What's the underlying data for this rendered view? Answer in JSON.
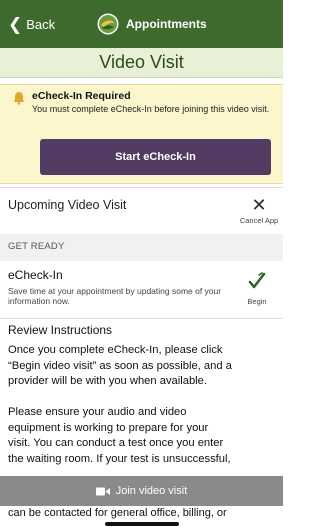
{
  "nav": {
    "back_label": "Back",
    "app_title": "Appointments"
  },
  "page": {
    "title": "Video Visit"
  },
  "banner": {
    "title": "eCheck-In Required",
    "text": "You must complete eCheck-In before joining this video visit.",
    "button_label": "Start eCheck-In"
  },
  "upcoming": {
    "label": "Upcoming Video Visit",
    "cancel_label": "Cancel App"
  },
  "get_ready": {
    "section_label": "GET READY",
    "echeckin_title": "eCheck-In",
    "echeckin_text": "Save time at your appointment by updating some of your information now.",
    "begin_label": "Begin"
  },
  "review": {
    "title": "Review Instructions",
    "para1": [
      "Once you complete eCheck-In, please click",
      "“Begin video visit” as soon as possible, and a",
      "provider will be with you when available."
    ],
    "para2": [
      "Please ensure your audio and video",
      "equipment is working to prepare for your",
      "visit. You can conduct a test once you enter",
      "the waiting room. If your test is unsuccessful,"
    ],
    "partial_line": "can be contacted for general office, billing, or"
  },
  "join": {
    "label": "Join video visit"
  },
  "colors": {
    "header_green": "#3e6b2d",
    "subheader_bg": "#e9f0d8",
    "banner_bg": "#fbf6cc",
    "button_purple": "#523c63",
    "join_bar": "#8a8a8a"
  },
  "icons": {
    "back": "chevron-left-icon",
    "logo": "app-logo",
    "warning": "warning-bell-icon",
    "cancel": "close-icon",
    "begin": "checkmark-icon",
    "camera": "video-camera-icon"
  }
}
